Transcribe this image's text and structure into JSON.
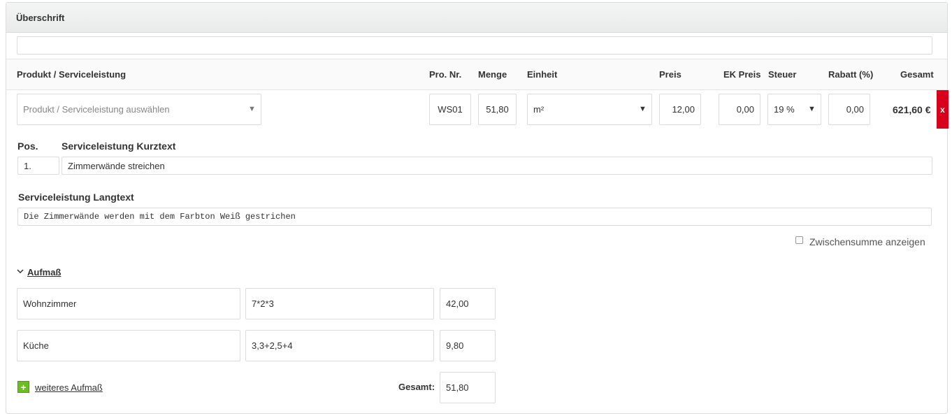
{
  "panel": {
    "title": "Überschrift",
    "title_field_value": ""
  },
  "table": {
    "headers": {
      "product": "Produkt / Serviceleistung",
      "pro_nr": "Pro. Nr.",
      "menge": "Menge",
      "einheit": "Einheit",
      "preis": "Preis",
      "ek_preis": "EK Preis",
      "steuer": "Steuer",
      "rabatt": "Rabatt (%)",
      "gesamt": "Gesamt"
    },
    "row": {
      "product_placeholder": "Produkt / Serviceleistung auswählen",
      "pro_nr": "WS01",
      "menge": "51,80",
      "einheit": "m²",
      "preis": "12,00",
      "ek_preis": "0,00",
      "steuer": "19 %",
      "rabatt": "0,00",
      "gesamt": "621,60 €",
      "delete_label": "x"
    }
  },
  "details": {
    "pos_label": "Pos.",
    "pos_value": "1.",
    "kurztext_label": "Serviceleistung Kurztext",
    "kurztext_value": "Zimmerwände streichen",
    "langtext_label": "Serviceleistung Langtext",
    "langtext_value": "Die Zimmerwände werden mit dem Farbton Weiß gestrichen",
    "zwischensumme_label": "Zwischensumme anzeigen"
  },
  "aufmass": {
    "toggle_label": "Aufmaß",
    "rows": [
      {
        "name": "Wohnzimmer",
        "formula": "7*2*3",
        "result": "42,00"
      },
      {
        "name": "Küche",
        "formula": "3,3+2,5+4",
        "result": "9,80"
      }
    ],
    "add_label": "weiteres Aufmaß",
    "total_label": "Gesamt:",
    "total_value": "51,80"
  },
  "icons": {
    "caret": "▼",
    "chevron": "chevron-down-icon",
    "plus": "plus-icon",
    "delete": "close-icon"
  },
  "colors": {
    "delete": "#d9001b",
    "add": "#6abf1f"
  }
}
